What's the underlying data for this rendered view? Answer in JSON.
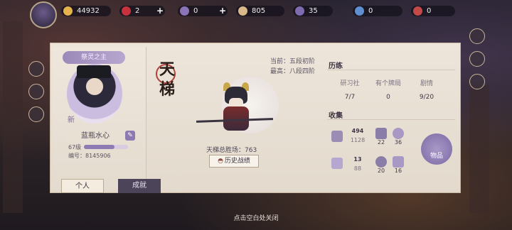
{
  "resources": [
    {
      "icon": "coin-icon",
      "value": "44932",
      "color": "#e6b24a"
    },
    {
      "icon": "heart-icon",
      "value": "2",
      "color": "#c8323c"
    },
    {
      "icon": "jade-icon",
      "value": "0",
      "color": "#8c74b9"
    },
    {
      "icon": "scroll-icon",
      "value": "805",
      "color": "#d9b88a"
    },
    {
      "icon": "moon-icon",
      "value": "35",
      "color": "#7e6bb0"
    },
    {
      "icon": "crystal-icon",
      "value": "0",
      "color": "#5e8fd1"
    },
    {
      "icon": "token-icon",
      "value": "0",
      "color": "#c44a4a"
    }
  ],
  "profile": {
    "title": "祭灵之主",
    "name": "蓝瓶水心",
    "level": "67级",
    "uid": "编号：8145906",
    "new_label": "新",
    "level_progress": 0.7
  },
  "tabs": {
    "personal": "个人",
    "achievement": "成就"
  },
  "ranked": {
    "mode_title": "天梯",
    "current": "当前：五段初阶",
    "highest": "最高：八段四阶",
    "total_wins": "天梯总胜场：763",
    "history_button": "历史战绩"
  },
  "experience": {
    "title": "历练",
    "stats": [
      {
        "label": "研习社",
        "value": "7/7"
      },
      {
        "label": "有个牌局",
        "value": "0"
      },
      {
        "label": "剧情",
        "value": "9/20"
      }
    ]
  },
  "collection": {
    "title": "收集",
    "cards": {
      "value": "494",
      "total": "1128"
    },
    "cards_b": "22",
    "cards_c": "36",
    "skins": {
      "value": "13",
      "total": "88"
    },
    "skins_b": "20",
    "skins_c": "16",
    "goods_label": "物品"
  },
  "close_hint": "点击空白处关闭"
}
